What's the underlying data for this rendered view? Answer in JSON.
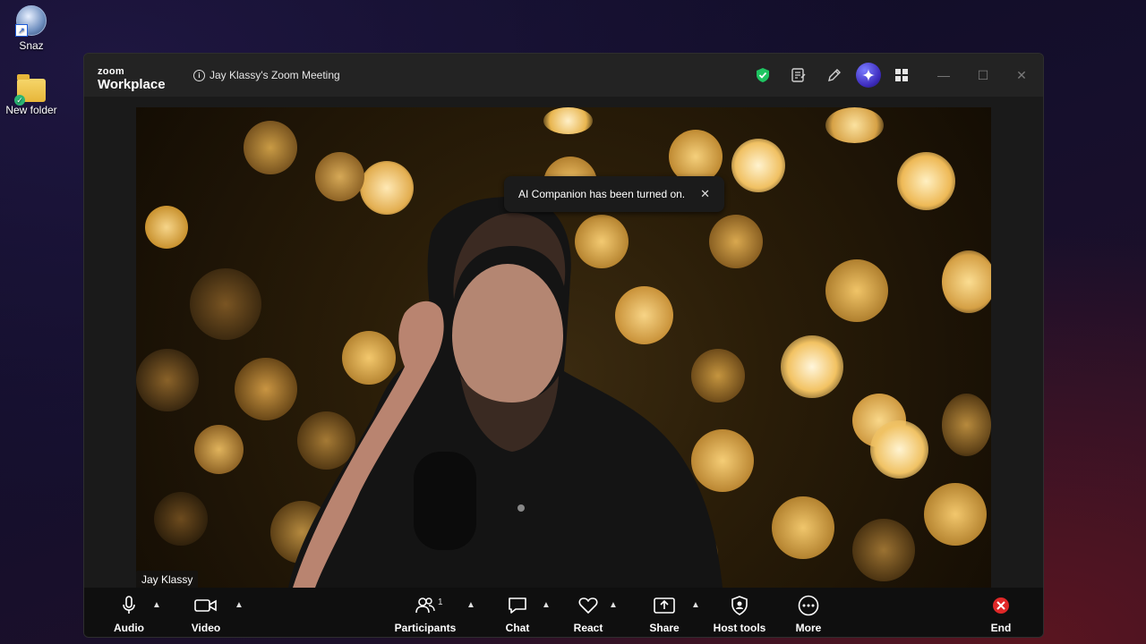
{
  "desktop": {
    "icons": [
      {
        "label": "Snaz"
      },
      {
        "label": "New folder"
      }
    ]
  },
  "window": {
    "brand_top": "zoom",
    "brand_bottom": "Workplace",
    "meeting_title": "Jay Klassy's Zoom Meeting",
    "title_icons": [
      "shield-icon",
      "notes-icon",
      "pen-icon",
      "ai-companion-icon",
      "apps-icon"
    ],
    "colors": {
      "shield": "#1ec461",
      "companion": "#4b3bdc",
      "end": "#e02828"
    }
  },
  "video": {
    "participant_name": "Jay Klassy",
    "toast": {
      "text": "AI Companion has been turned on."
    }
  },
  "toolbar": {
    "audio": "Audio",
    "video": "Video",
    "participants": "Participants",
    "participants_count": "1",
    "chat": "Chat",
    "react": "React",
    "share": "Share",
    "host_tools": "Host tools",
    "more": "More",
    "end": "End"
  }
}
